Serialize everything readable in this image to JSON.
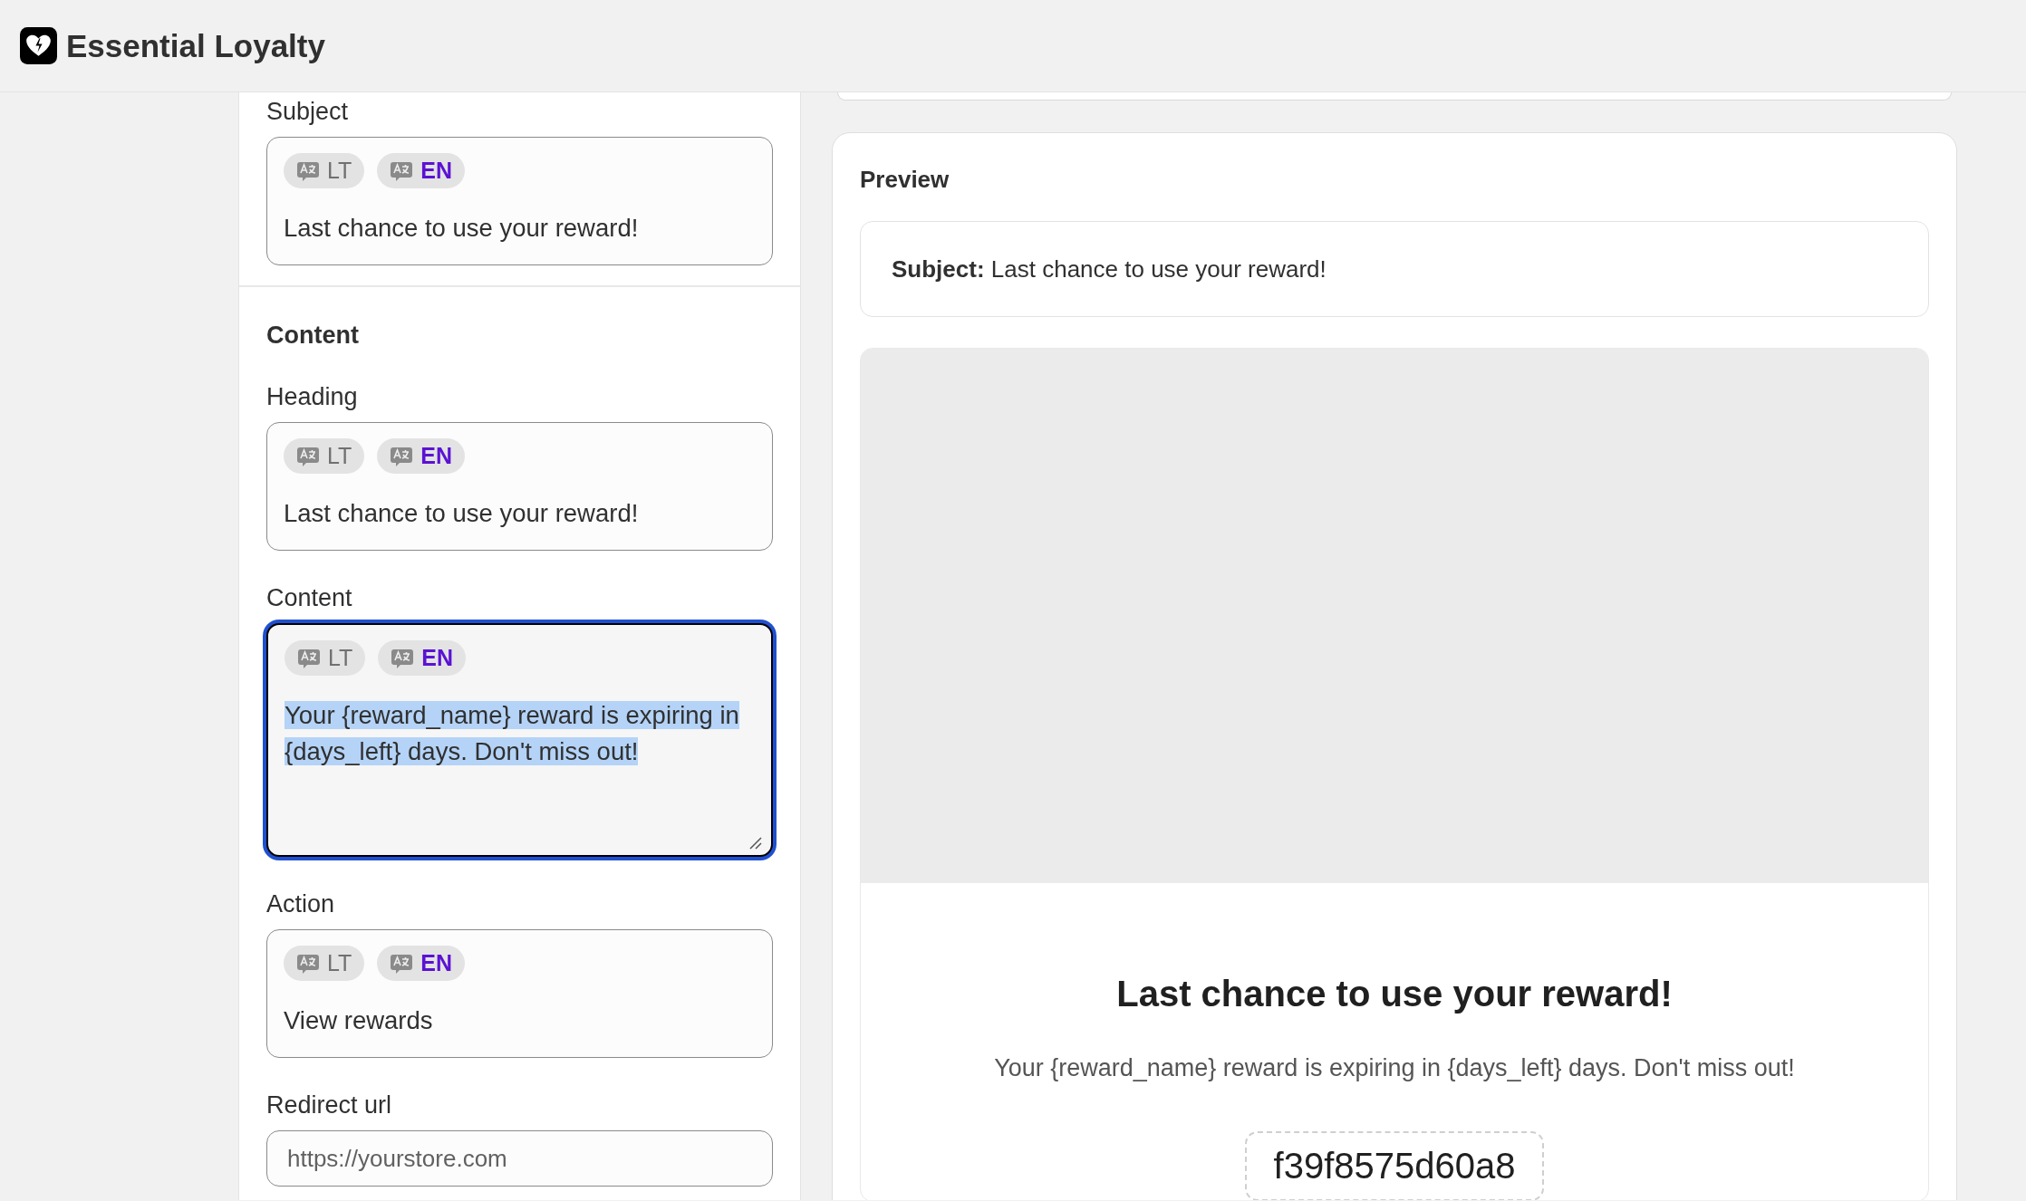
{
  "header": {
    "title": "Essential Loyalty"
  },
  "form": {
    "sections": [
      {
        "fields": [
          {
            "kind": "translatable",
            "label": "Subject",
            "languages": [
              {
                "code": "LT",
                "selected": false
              },
              {
                "code": "EN",
                "selected": true
              }
            ],
            "value": "Last chance to use your reward!",
            "focused": false,
            "text_selected": false
          }
        ]
      },
      {
        "title": "Content",
        "fields": [
          {
            "kind": "translatable",
            "label": "Heading",
            "languages": [
              {
                "code": "LT",
                "selected": false
              },
              {
                "code": "EN",
                "selected": true
              }
            ],
            "value": "Last chance to use your reward!",
            "focused": false,
            "text_selected": false
          },
          {
            "kind": "textarea",
            "label": "Content",
            "languages": [
              {
                "code": "LT",
                "selected": false
              },
              {
                "code": "EN",
                "selected": true
              }
            ],
            "value": "Your {reward_name} reward is expiring in {days_left} days. Don't miss out!",
            "focused": true,
            "text_selected": true
          },
          {
            "kind": "translatable",
            "label": "Action",
            "languages": [
              {
                "code": "LT",
                "selected": false
              },
              {
                "code": "EN",
                "selected": true
              }
            ],
            "value": "View rewards",
            "focused": false,
            "text_selected": false
          },
          {
            "kind": "url",
            "label": "Redirect url",
            "placeholder": "https://yourstore.com"
          }
        ]
      }
    ]
  },
  "preview": {
    "title": "Preview",
    "subject": "**Subject:** Last chance to use your reward!",
    "email": {
      "heading": "Last chance to use your reward!",
      "body": "Your {reward_name} reward is expiring in {days_left} days. Don't miss out!",
      "code": "f39f8575d60a8"
    }
  }
}
